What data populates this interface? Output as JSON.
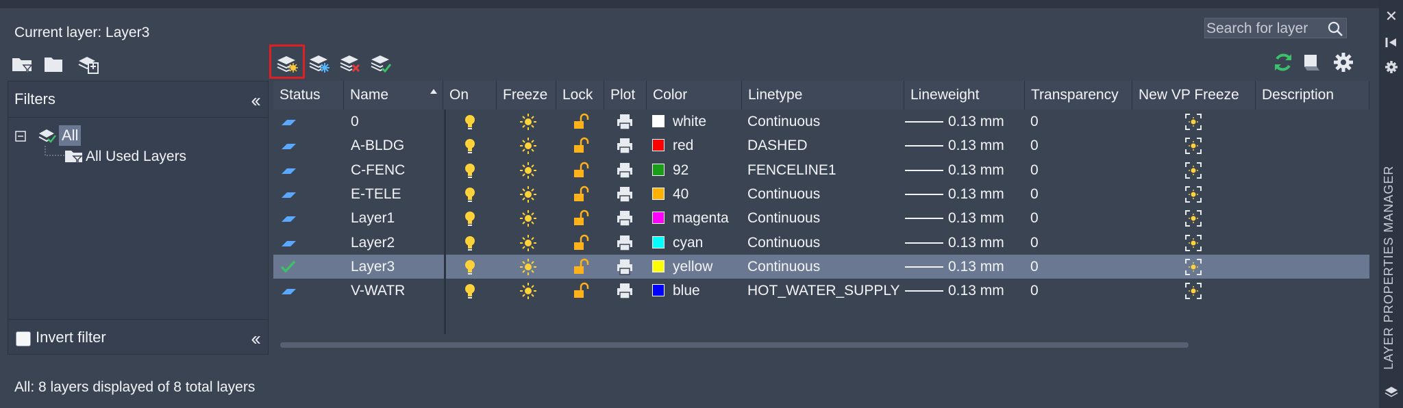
{
  "header": {
    "current_layer": "Current layer: Layer3"
  },
  "search": {
    "placeholder": "Search for layer"
  },
  "filters": {
    "title": "Filters",
    "tree": {
      "all": "All",
      "used": "All Used Layers"
    },
    "invert_label": "Invert filter"
  },
  "columns": [
    "Status",
    "Name",
    "On",
    "Freeze",
    "Lock",
    "Plot",
    "Color",
    "Linetype",
    "Lineweight",
    "Transparency",
    "New VP Freeze",
    "Description"
  ],
  "layers": [
    {
      "name": "0",
      "color_name": "white",
      "color_hex": "#ffffff",
      "linetype": "Continuous",
      "lineweight": "0.13 mm",
      "transparency": "0",
      "current": false
    },
    {
      "name": "A-BLDG",
      "color_name": "red",
      "color_hex": "#ff0000",
      "linetype": "DASHED",
      "lineweight": "0.13 mm",
      "transparency": "0",
      "current": false
    },
    {
      "name": "C-FENC",
      "color_name": "92",
      "color_hex": "#1a9e1a",
      "linetype": "FENCELINE1",
      "lineweight": "0.13 mm",
      "transparency": "0",
      "current": false
    },
    {
      "name": "E-TELE",
      "color_name": "40",
      "color_hex": "#ffb000",
      "linetype": "Continuous",
      "lineweight": "0.13 mm",
      "transparency": "0",
      "current": false
    },
    {
      "name": "Layer1",
      "color_name": "magenta",
      "color_hex": "#ff00ff",
      "linetype": "Continuous",
      "lineweight": "0.13 mm",
      "transparency": "0",
      "current": false
    },
    {
      "name": "Layer2",
      "color_name": "cyan",
      "color_hex": "#00ffff",
      "linetype": "Continuous",
      "lineweight": "0.13 mm",
      "transparency": "0",
      "current": false
    },
    {
      "name": "Layer3",
      "color_name": "yellow",
      "color_hex": "#ffff00",
      "linetype": "Continuous",
      "lineweight": "0.13 mm",
      "transparency": "0",
      "current": true
    },
    {
      "name": "V-WATR",
      "color_name": "blue",
      "color_hex": "#0000ff",
      "linetype": "HOT_WATER_SUPPLY",
      "lineweight": "0.13 mm",
      "transparency": "0",
      "current": false
    }
  ],
  "status_text": "All: 8 layers displayed of 8 total layers",
  "palette_title": "LAYER PROPERTIES MANAGER",
  "icons": {
    "toolbar_left": [
      "new-property-filter-icon",
      "new-group-filter-icon",
      "layer-states-manager-icon"
    ],
    "toolbar_grid": [
      "new-layer-icon",
      "new-layer-vp-frozen-icon",
      "delete-layer-icon",
      "set-current-icon"
    ],
    "toolbar_right": [
      "refresh-icon",
      "settings-toggle-icon",
      "settings-gear-icon"
    ]
  },
  "colors": {
    "selected_row": "#6a7991",
    "accent_green": "#3cc06a",
    "bulb": "#ffd23a",
    "active_outline": "#e02020"
  }
}
